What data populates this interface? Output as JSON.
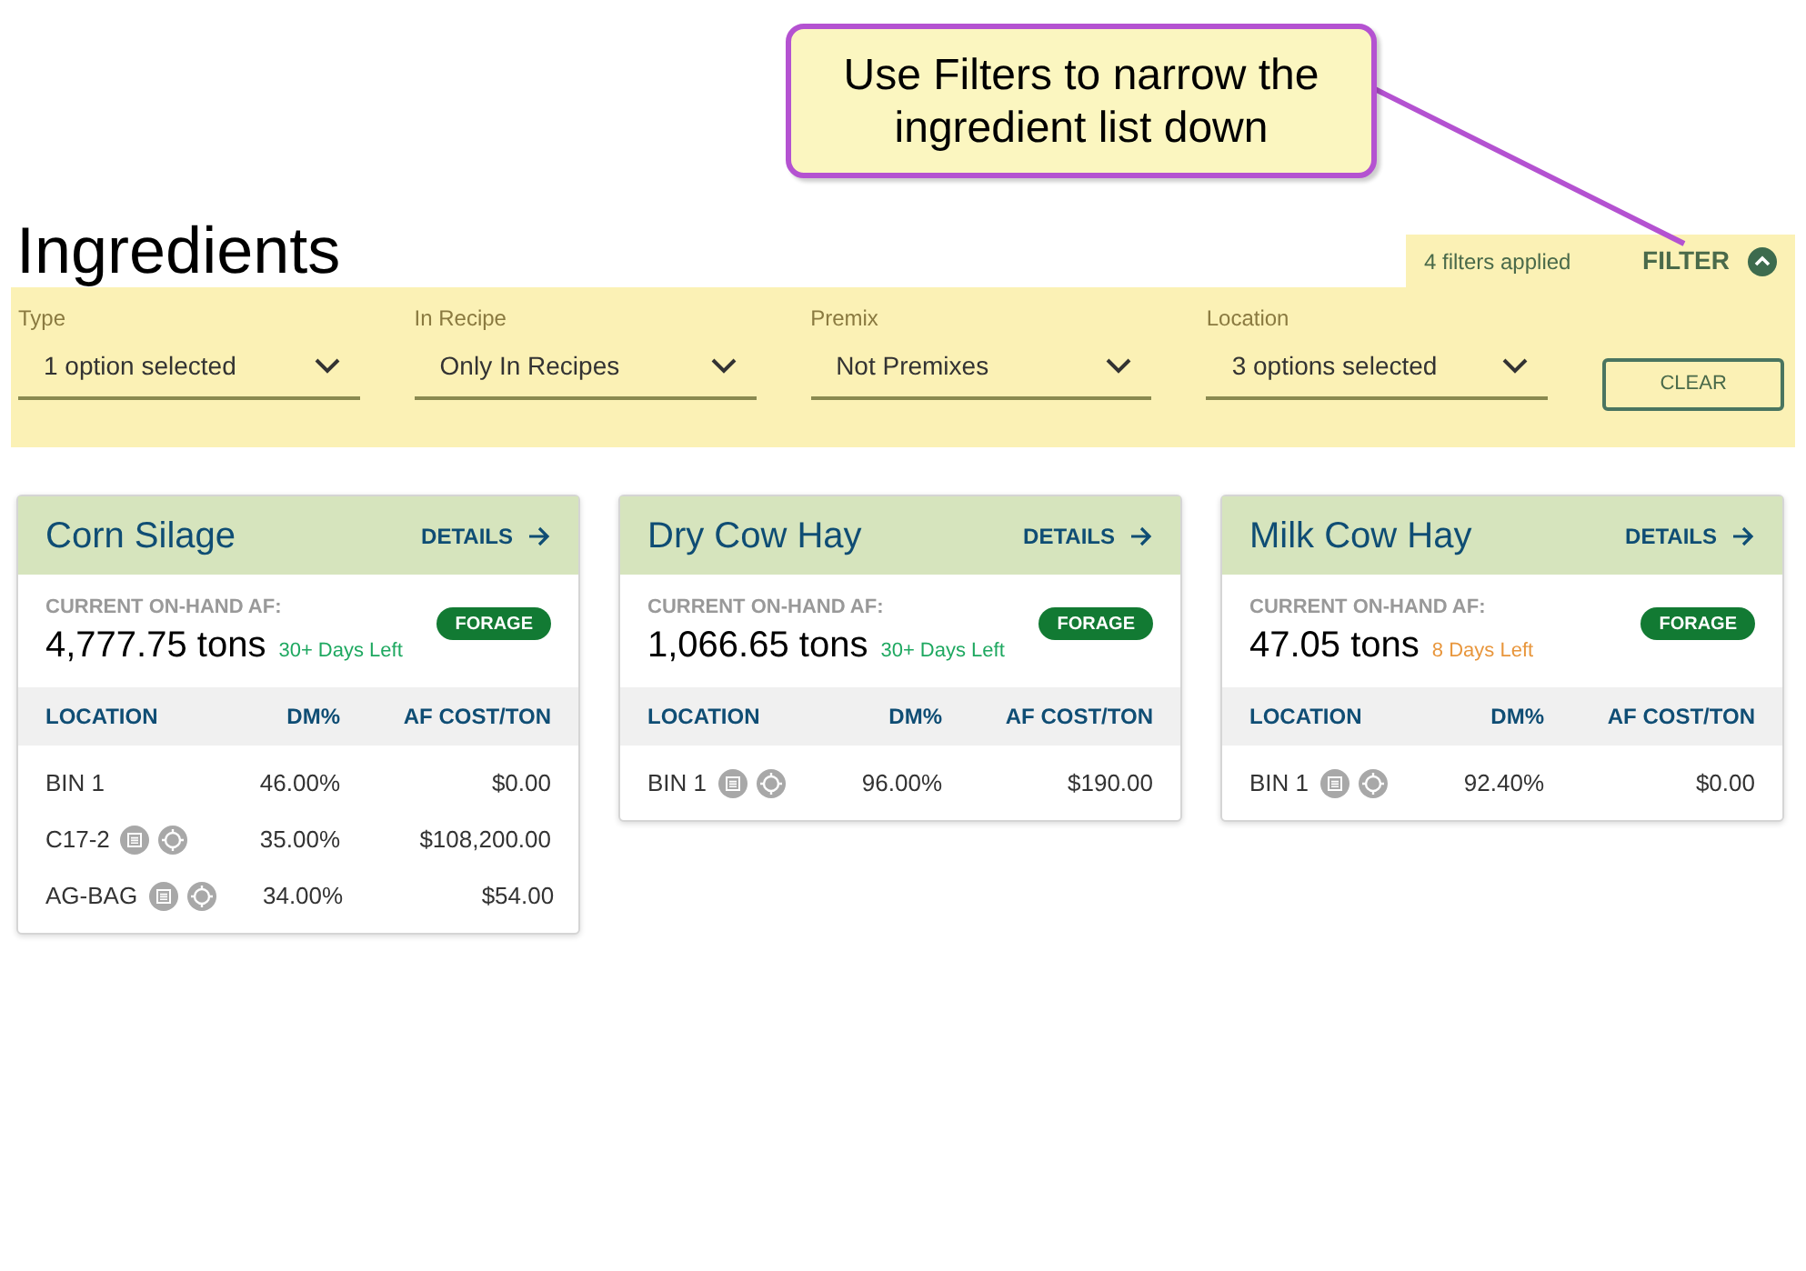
{
  "callout": {
    "text": "Use Filters to narrow the ingredient list down"
  },
  "title": "Ingredients",
  "filter_bar": {
    "applied": "4 filters applied",
    "toggle": "FILTER",
    "expanded": true,
    "dropdowns": [
      {
        "label": "Type",
        "value": "1 option selected"
      },
      {
        "label": "In Recipe",
        "value": "Only In Recipes"
      },
      {
        "label": "Premix",
        "value": "Not Premixes"
      },
      {
        "label": "Location",
        "value": "3 options selected"
      }
    ],
    "clear": "CLEAR"
  },
  "cards": [
    {
      "name": "Corn Silage",
      "details": "DETAILS",
      "on_hand_label": "CURRENT ON-HAND AF:",
      "amount": "4,777.75 tons",
      "days_left": "30+ Days Left",
      "color": "#1ea860",
      "tag": "FORAGE",
      "columns": [
        "LOCATION",
        "DM%",
        "AF COST/TON"
      ],
      "rows": [
        {
          "location": "BIN 1",
          "icons": false,
          "dm": "46.00%",
          "cost": "$0.00"
        },
        {
          "location": "C17-2",
          "icons": true,
          "dm": "35.00%",
          "cost": "$108,200.00"
        },
        {
          "location": "AG-BAG",
          "icons": true,
          "dm": "34.00%",
          "cost": "$54.00"
        }
      ]
    },
    {
      "name": "Dry Cow Hay",
      "details": "DETAILS",
      "on_hand_label": "CURRENT ON-HAND AF:",
      "amount": "1,066.65 tons",
      "days_left": "30+ Days Left",
      "color": "#1ea860",
      "tag": "FORAGE",
      "columns": [
        "LOCATION",
        "DM%",
        "AF COST/TON"
      ],
      "rows": [
        {
          "location": "BIN 1",
          "icons": true,
          "dm": "96.00%",
          "cost": "$190.00"
        }
      ]
    },
    {
      "name": "Milk Cow Hay",
      "details": "DETAILS",
      "on_hand_label": "CURRENT ON-HAND AF:",
      "amount": "47.05 tons",
      "days_left": "8 Days Left",
      "color": "#e8963c",
      "tag": "FORAGE",
      "columns": [
        "LOCATION",
        "DM%",
        "AF COST/TON"
      ],
      "rows": [
        {
          "location": "BIN 1",
          "icons": true,
          "dm": "92.40%",
          "cost": "$0.00"
        }
      ]
    }
  ]
}
